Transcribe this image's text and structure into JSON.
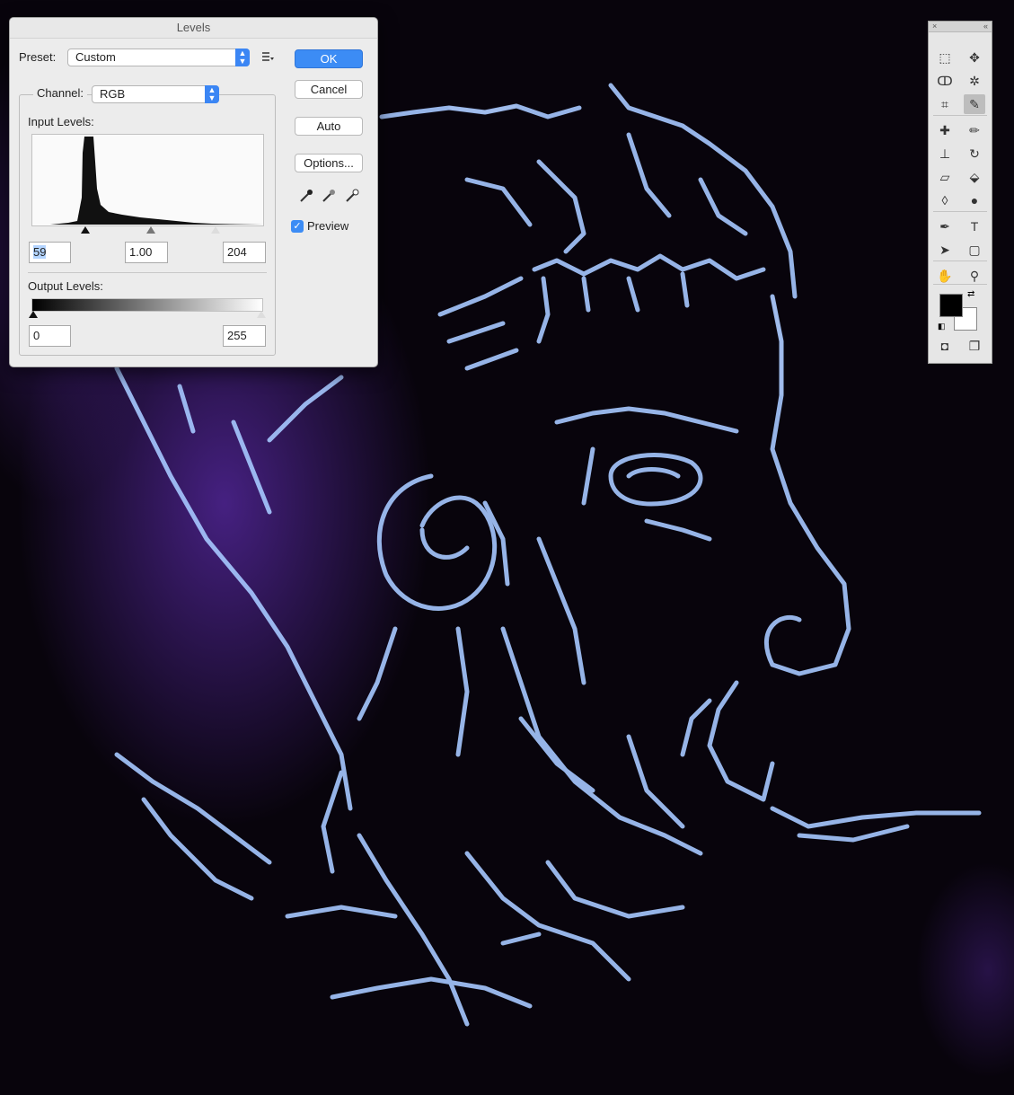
{
  "dialog": {
    "title": "Levels",
    "preset_label": "Preset:",
    "preset_value": "Custom",
    "channel_label": "Channel:",
    "channel_value": "RGB",
    "input_levels_label": "Input Levels:",
    "input_black": "59",
    "input_gamma": "1.00",
    "input_white": "204",
    "output_levels_label": "Output Levels:",
    "output_black": "0",
    "output_white": "255",
    "buttons": {
      "ok": "OK",
      "cancel": "Cancel",
      "auto": "Auto",
      "options": "Options..."
    },
    "preview_label": "Preview",
    "preview_checked": true
  },
  "colors": {
    "accent": "#3c8cf5",
    "canvas_background": "#08040c",
    "line_art": "#a6c8ff",
    "glow": "#5a2aa8"
  },
  "tools": [
    {
      "name": "rectangular-marquee-icon"
    },
    {
      "name": "move-icon"
    },
    {
      "name": "lasso-icon"
    },
    {
      "name": "quick-selection-icon"
    },
    {
      "name": "crop-icon"
    },
    {
      "name": "eyedropper-icon",
      "selected": true
    },
    {
      "name": "healing-brush-icon"
    },
    {
      "name": "brush-icon"
    },
    {
      "name": "clone-stamp-icon"
    },
    {
      "name": "history-brush-icon"
    },
    {
      "name": "eraser-icon"
    },
    {
      "name": "paint-bucket-icon"
    },
    {
      "name": "blur-icon"
    },
    {
      "name": "dodge-icon"
    },
    {
      "name": "pen-icon"
    },
    {
      "name": "type-icon"
    },
    {
      "name": "path-selection-icon"
    },
    {
      "name": "shape-icon"
    },
    {
      "name": "hand-icon"
    },
    {
      "name": "zoom-icon"
    },
    {
      "name": "quick-mask-icon"
    },
    {
      "name": "screen-mode-icon"
    }
  ],
  "tool_glyphs": {
    "type-icon": "T"
  },
  "foreground_color": "#000000",
  "background_color": "#ffffff"
}
